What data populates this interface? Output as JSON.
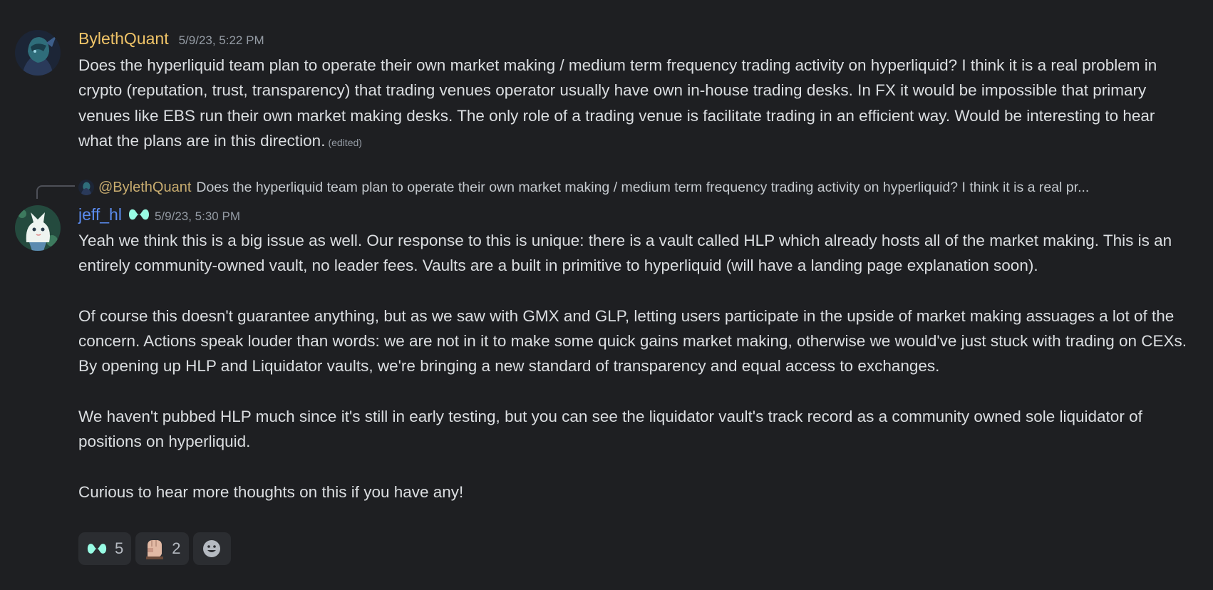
{
  "messages": [
    {
      "author": "BylethQuant",
      "timestamp": "5/9/23, 5:22 PM",
      "edited_label": "(edited)",
      "paragraphs": [
        "Does the hyperliquid team plan to operate their own market making / medium term frequency trading activity on hyperliquid? I think it is a real problem in crypto (reputation, trust, transparency) that trading venues operator usually have own in-house trading desks. In FX it would be impossible that primary venues like EBS run their own market making desks. The only role of a trading venue is facilitate trading in an efficient way. Would be interesting to hear what the plans are in this direction."
      ]
    },
    {
      "author": "jeff_hl",
      "timestamp": "5/9/23, 5:30 PM",
      "reply": {
        "mention": "@BylethQuant",
        "text": "Does the hyperliquid team plan to operate their own market making / medium term frequency trading activity on hyperliquid? I think it is a real pr..."
      },
      "paragraphs": [
        "Yeah we think this is a big issue as well. Our response to this is unique: there is a vault called HLP which already hosts all of the market making. This is an entirely community-owned vault, no leader fees. Vaults are a built in primitive to hyperliquid (will have a landing page explanation soon).",
        "Of course this doesn't guarantee anything, but as we saw with GMX and GLP, letting users participate in the upside of market making assuages a lot of the concern. Actions speak louder than words: we are not in it to make some quick gains market making, otherwise we would've just stuck with trading on CEXs. By opening up HLP and Liquidator vaults, we're bringing a new standard of transparency and equal access to exchanges.",
        "We haven't pubbed HLP much since it's still in early testing, but you can see the liquidator vault's track record as a community owned sole liquidator of positions on hyperliquid.",
        "Curious to hear more thoughts on this if you have any!"
      ],
      "reactions": [
        {
          "icon": "hyperliquid-logo-icon",
          "count": "5"
        },
        {
          "icon": "hand-emoji-icon",
          "count": "2"
        }
      ]
    }
  ],
  "colors": {
    "background": "#1e1f22",
    "author_gold": "#f0c468",
    "author_blue": "#5b8cf0",
    "text": "#dbdee1",
    "muted": "#949ba4",
    "reaction_bg": "#2b2d31",
    "hl_mint": "#98fce4"
  }
}
